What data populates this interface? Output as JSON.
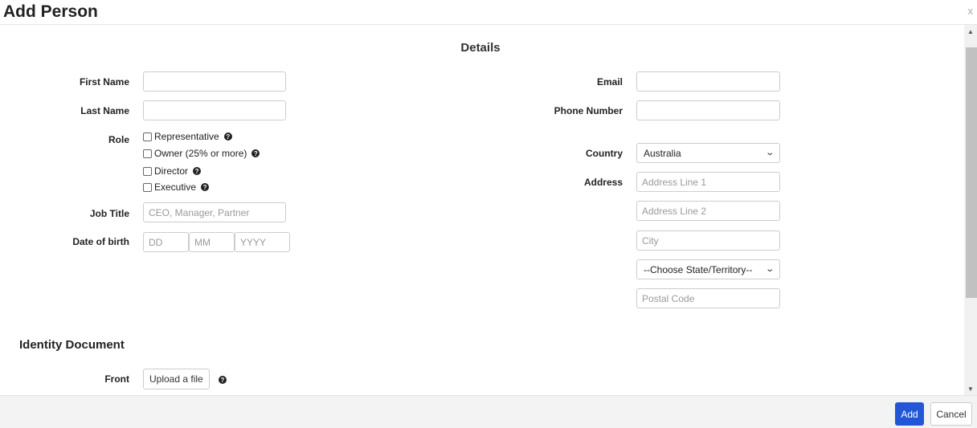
{
  "dialog": {
    "title": "Add Person",
    "close_label": "x"
  },
  "details": {
    "section_title": "Details",
    "first_name_label": "First Name",
    "last_name_label": "Last Name",
    "role_label": "Role",
    "roles": [
      "Representative",
      "Owner (25% or more)",
      "Director",
      "Executive"
    ],
    "job_title_label": "Job Title",
    "job_title_placeholder": "CEO, Manager, Partner",
    "dob_label": "Date of birth",
    "dob_day_placeholder": "DD",
    "dob_month_placeholder": "MM",
    "dob_year_placeholder": "YYYY",
    "email_label": "Email",
    "phone_label": "Phone Number",
    "country_label": "Country",
    "country_value": "Australia",
    "address_label": "Address",
    "address_line1_placeholder": "Address Line 1",
    "address_line2_placeholder": "Address Line 2",
    "city_placeholder": "City",
    "state_value": "--Choose State/Territory--",
    "postal_placeholder": "Postal Code"
  },
  "identity": {
    "section_title": "Identity Document",
    "front_label": "Front",
    "upload_label": "Upload a file"
  },
  "footer": {
    "add_label": "Add",
    "cancel_label": "Cancel"
  },
  "colors": {
    "primary": "#2157d6",
    "footer_bg": "#f3f3f3"
  },
  "icons": [
    "close-icon",
    "help-icon",
    "chevron-down-icon",
    "scroll-up-icon",
    "scroll-down-icon"
  ]
}
